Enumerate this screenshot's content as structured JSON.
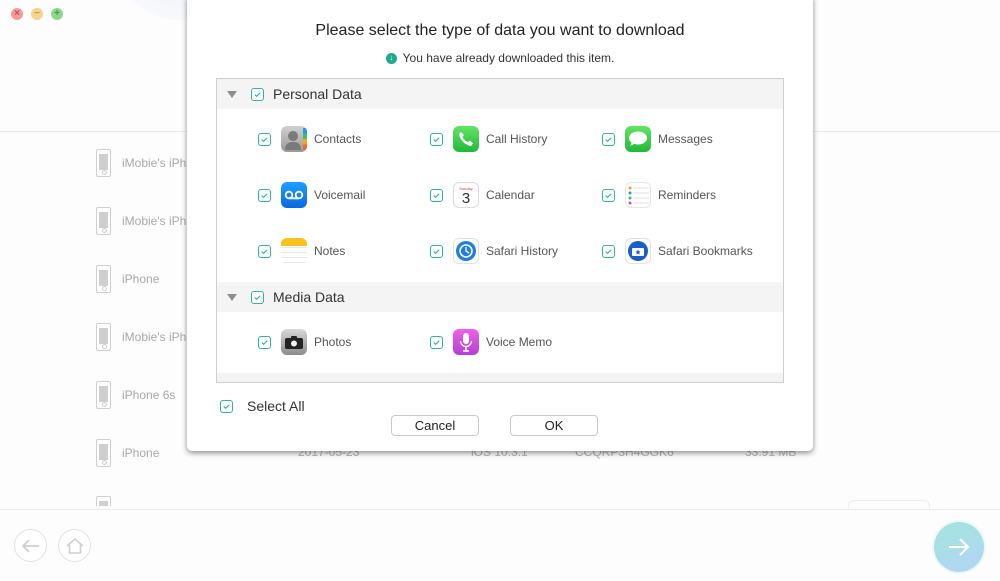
{
  "window": {
    "controls": [
      "close",
      "minimize",
      "maximize"
    ]
  },
  "devices": [
    {
      "name": "iMobie's iPh",
      "icon": "iphone-icon"
    },
    {
      "name": "iMobie's iPh",
      "icon": "iphone-icon"
    },
    {
      "name": "iPhone",
      "icon": "iphone-icon"
    },
    {
      "name": "iMobie's iPh",
      "icon": "iphone-icon"
    },
    {
      "name": "iPhone 6s",
      "icon": "iphone-icon"
    },
    {
      "name": "iPhone",
      "icon": "iphone-icon",
      "date": "2017-05-23",
      "ios": "iOS 10.3.1",
      "serial": "CCQRP3H4GGK6",
      "size": "33.91 MB"
    }
  ],
  "dialog": {
    "title": "Please select the type of data you want to download",
    "note": "You have already downloaded this item.",
    "note_icon": "download-done-icon",
    "categories": [
      {
        "label": "Personal Data",
        "checked": true,
        "expanded": true,
        "items": [
          {
            "label": "Contacts",
            "icon": "contacts-icon",
            "checked": true
          },
          {
            "label": "Call History",
            "icon": "phone-icon",
            "checked": true
          },
          {
            "label": "Messages",
            "icon": "messages-icon",
            "checked": true
          },
          {
            "label": "Voicemail",
            "icon": "voicemail-icon",
            "checked": true
          },
          {
            "label": "Calendar",
            "icon": "calendar-icon",
            "checked": true
          },
          {
            "label": "Reminders",
            "icon": "reminders-icon",
            "checked": true
          },
          {
            "label": "Notes",
            "icon": "notes-icon",
            "checked": true
          },
          {
            "label": "Safari History",
            "icon": "safari-history-icon",
            "checked": true
          },
          {
            "label": "Safari Bookmarks",
            "icon": "safari-bookmarks-icon",
            "checked": true
          }
        ]
      },
      {
        "label": "Media Data",
        "checked": true,
        "expanded": true,
        "items": [
          {
            "label": "Photos",
            "icon": "camera-icon",
            "checked": true
          },
          {
            "label": "Voice Memo",
            "icon": "microphone-icon",
            "checked": true
          }
        ]
      }
    ],
    "calendar_icon_day": "Sunday",
    "calendar_icon_date": "3",
    "select_all_label": "Select All",
    "select_all_checked": true,
    "cancel_label": "Cancel",
    "ok_label": "OK"
  },
  "footer": {
    "back_icon": "back-arrow-icon",
    "home_icon": "home-icon",
    "next_icon": "next-arrow-icon"
  },
  "colors": {
    "accent": "#2bb5a2",
    "download_note": "#1aab8a",
    "next_gradient_start": "#a2e6dc",
    "next_gradient_end": "#b3d4f7"
  }
}
